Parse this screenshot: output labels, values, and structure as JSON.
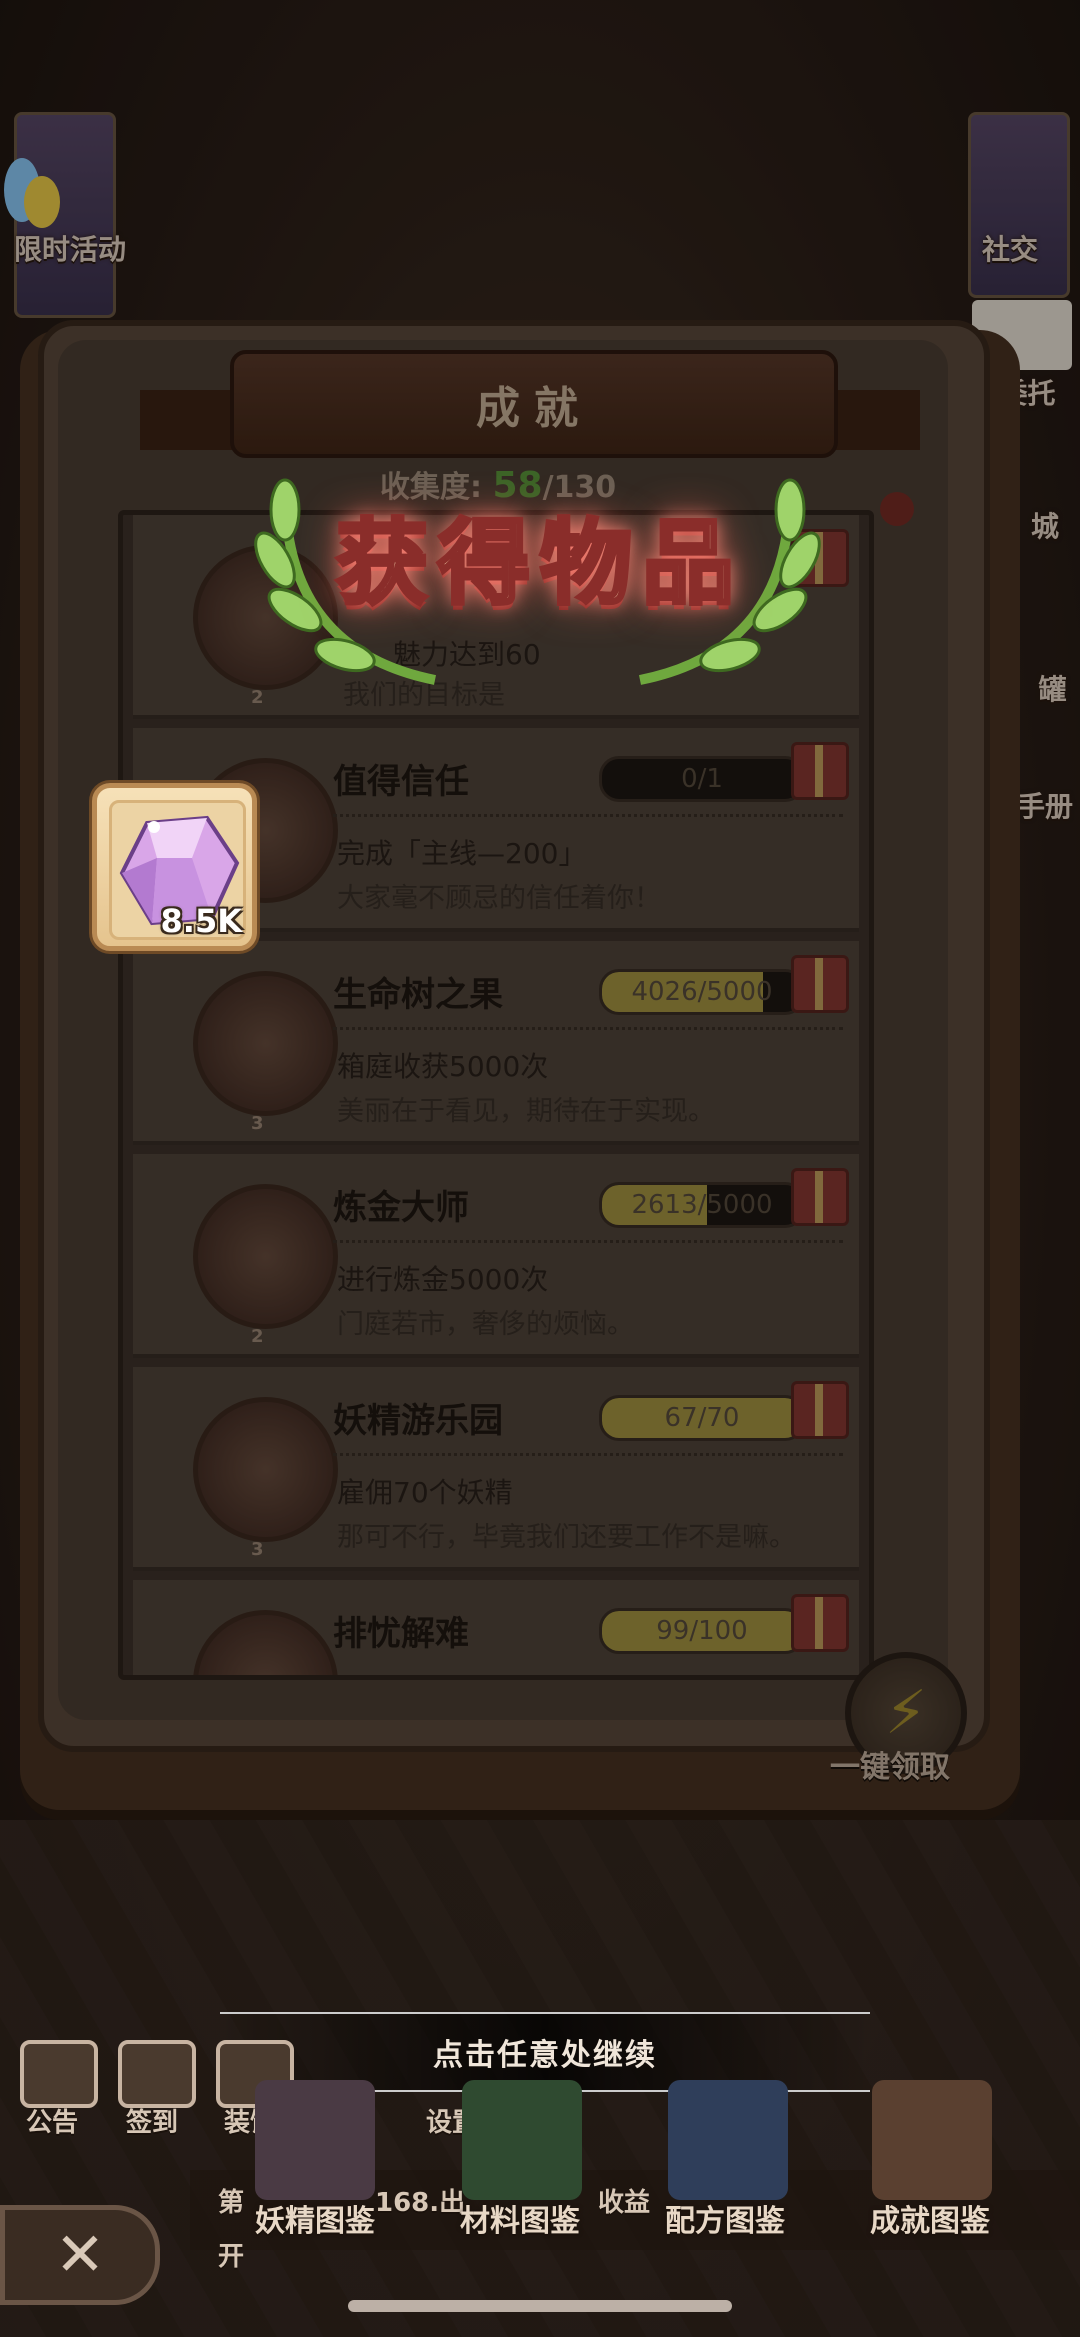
{
  "side": {
    "left_top": "限时活动",
    "right_top": "社交",
    "right_2": "委托",
    "right_3": "城",
    "right_4": "罐",
    "right_5": "手册"
  },
  "book": {
    "title": "成就",
    "collect_label": "收集度:",
    "collect_value": "58",
    "collect_total": "/130"
  },
  "overlay": {
    "title": "获得物品",
    "item_count": "8.5K"
  },
  "achievements": [
    {
      "name": "",
      "progress_text": "",
      "progress": 0.0,
      "desc": "魅力达到60",
      "sub": "我们的目标是",
      "level": "2"
    },
    {
      "name": "值得信任",
      "progress_text": "0/1",
      "progress": 0.0,
      "desc": "完成「主线—200」",
      "sub": "大家毫不顾忌的信任着你！",
      "level": ""
    },
    {
      "name": "生命树之果",
      "progress_text": "4026/5000",
      "progress": 0.805,
      "desc": "箱庭收获5000次",
      "sub": "美丽在于看见，期待在于实现。",
      "level": "3"
    },
    {
      "name": "炼金大师",
      "progress_text": "2613/5000",
      "progress": 0.523,
      "desc": "进行炼金5000次",
      "sub": "门庭若市，奢侈的烦恼。",
      "level": "2"
    },
    {
      "name": "妖精游乐园",
      "progress_text": "67/70",
      "progress": 0.957,
      "desc": "雇佣70个妖精",
      "sub": "那可不行，毕竟我们还要工作不是嘛。",
      "level": "3"
    },
    {
      "name": "排忧解难",
      "progress_text": "99/100",
      "progress": 0.99,
      "desc": "",
      "sub": "",
      "level": ""
    }
  ],
  "one_key": {
    "label": "一键领取"
  },
  "continue_text": "点击任意处继续",
  "bottom_left": [
    {
      "label": "公告",
      "icon": "notice-icon"
    },
    {
      "label": "签到",
      "icon": "checkin-icon"
    },
    {
      "label": "装饰",
      "icon": "decor-icon"
    },
    {
      "label": "设置",
      "icon": "settings-icon"
    }
  ],
  "book_tabs": [
    {
      "label": "妖精图鉴",
      "color": "#4a3a44"
    },
    {
      "label": "材料图鉴",
      "color": "#2f4a30"
    },
    {
      "label": "配方图鉴",
      "color": "#2f3e5a"
    },
    {
      "label": "成就图鉴",
      "color": "#5a4030"
    }
  ],
  "bottom_fragments": {
    "left": "第",
    "mid": "168.出",
    "right": "收益",
    "open": "开"
  }
}
